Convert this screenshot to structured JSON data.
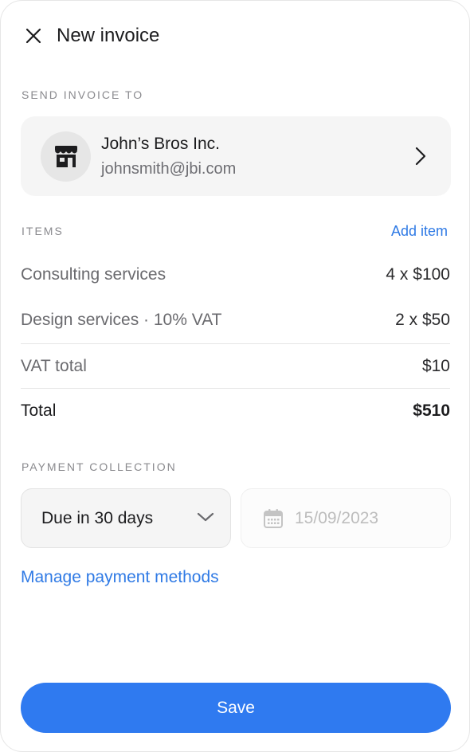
{
  "header": {
    "title": "New invoice",
    "close_icon": "close-icon"
  },
  "recipient_section": {
    "label": "SEND INVOICE TO",
    "name": "John’s Bros Inc.",
    "email": "johnsmith@jbi.com",
    "avatar_icon": "store-icon",
    "chevron_icon": "chevron-right-icon"
  },
  "items_section": {
    "label": "ITEMS",
    "add_label": "Add item",
    "items": [
      {
        "name": "Consulting services",
        "amount": "4 x $100"
      },
      {
        "name": "Design services · 10% VAT",
        "amount": "2 x $50"
      }
    ],
    "vat": {
      "label": "VAT total",
      "value": "$10"
    },
    "total": {
      "label": "Total",
      "value": "$510"
    }
  },
  "payment_section": {
    "label": "PAYMENT COLLECTION",
    "due_selected": "Due in 30 days",
    "date_placeholder": "15/09/2023",
    "manage_label": "Manage payment methods"
  },
  "footer": {
    "save_label": "Save"
  },
  "colors": {
    "accent": "#2f7af0",
    "link": "#2f7ae5",
    "surface": "#f5f5f5"
  }
}
